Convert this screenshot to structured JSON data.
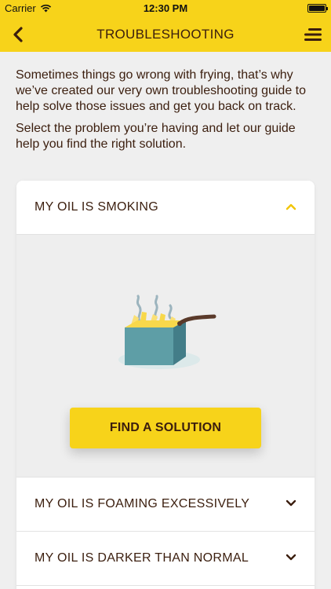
{
  "status_bar": {
    "carrier": "Carrier",
    "time": "12:30 PM",
    "wifi_icon": "wifi-icon",
    "battery_level": 1.0
  },
  "nav": {
    "title": "TROUBLESHOOTING",
    "back_icon": "chevron-left-icon",
    "menu_icon": "hamburger-menu-icon"
  },
  "intro": {
    "paragraph1": "Sometimes things go wrong with frying, that’s why we’ve created our very own troubleshooting guide to help solve those issues and get you back on track.",
    "paragraph2": "Select the problem you’re having and let our guide help you find the right solution."
  },
  "accordion": {
    "items": [
      {
        "label": "MY OIL IS SMOKING",
        "expanded": true,
        "icon": "chevron-up-icon"
      },
      {
        "label": "MY OIL IS FOAMING EXCESSIVELY",
        "expanded": false,
        "icon": "chevron-down-icon"
      },
      {
        "label": "MY OIL IS DARKER THAN NORMAL",
        "expanded": false,
        "icon": "chevron-down-icon"
      }
    ],
    "expanded_body": {
      "illustration": "smoking-fryer-illustration",
      "button_label": "FIND A SOLUTION"
    }
  },
  "colors": {
    "brand_yellow": "#F7D31A",
    "text_brown": "#3B1E0E",
    "panel_gray": "#EEEEEE",
    "background": "#EFEFEF"
  }
}
